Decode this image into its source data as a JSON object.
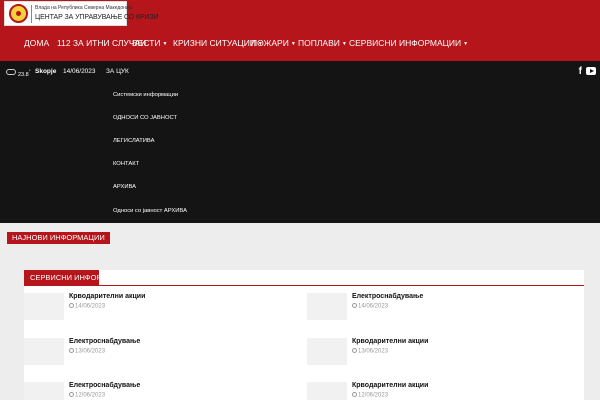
{
  "header": {
    "logo_line1": "Влада на Република Северна Македонија",
    "logo_line2": "ЦЕНТАР ЗА УПРАВУВАЊЕ СО КРИЗИ",
    "brand_color": "#b5151b"
  },
  "nav": {
    "items": [
      {
        "label": "ДОМА",
        "dropdown": false
      },
      {
        "label": "112 ЗА ИТНИ СЛУЧАИ",
        "dropdown": false
      },
      {
        "label": "ВЕСТИ",
        "dropdown": true
      },
      {
        "label": "КРИЗНИ СИТУАЦИИ",
        "dropdown": true
      },
      {
        "label": "ПОЖАРИ",
        "dropdown": true
      },
      {
        "label": "ПОПЛАВИ",
        "dropdown": true
      },
      {
        "label": "СЕРВИСНИ ИНФОРМАЦИИ",
        "dropdown": true
      }
    ]
  },
  "topbar": {
    "temperature": "23.8",
    "degree": "°",
    "city": "Skopje",
    "date": "14/06/2023",
    "about": "ЗА ЦУК",
    "weather_icon": "cloud-icon",
    "social": [
      "facebook-icon",
      "youtube-icon"
    ]
  },
  "dropdown": {
    "items": [
      "Системски информации",
      "ОДНОСИ СО ЈАВНОСТ",
      "ЛЕГИСЛАТИВА",
      "КОНТАКТ",
      "АРХИВА",
      "Односи со јавност АРХИВА"
    ]
  },
  "latest": {
    "label": "НАЈНОВИ ИНФОРМАЦИИ"
  },
  "services": {
    "tab_label": "СЕРВИСНИ ИНФОРМАЦИИ",
    "items": [
      {
        "title": "Крводарителни акции",
        "date": "14/06/2023"
      },
      {
        "title": "Електроснабдување",
        "date": "14/06/2023"
      },
      {
        "title": "Електроснабдување",
        "date": "13/06/2023"
      },
      {
        "title": "Крводарителни акции",
        "date": "13/06/2023"
      },
      {
        "title": "Електроснабдување",
        "date": "12/06/2023"
      },
      {
        "title": "Крводарителни акции",
        "date": "12/06/2023"
      }
    ]
  }
}
